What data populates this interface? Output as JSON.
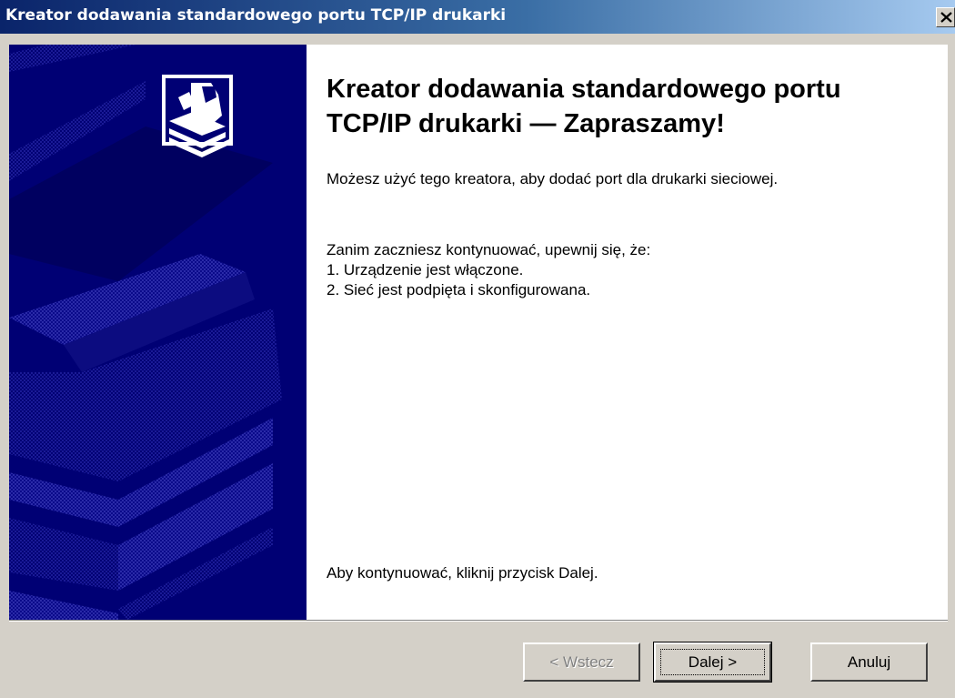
{
  "window": {
    "title": "Kreator dodawania standardowego portu TCP/IP drukarki",
    "close_icon": "close-icon"
  },
  "content": {
    "heading": "Kreator dodawania standardowego portu TCP/IP drukarki — Zapraszamy!",
    "intro": "Możesz użyć tego kreatora, aby dodać port dla drukarki sieciowej.",
    "prereq_header": "Zanim zaczniesz kontynuować, upewnij się, że:",
    "prereq_items": [
      "1.  Urządzenie jest włączone.",
      "2.  Sieć jest podpięta i skonfigurowana."
    ],
    "bottom_hint": "Aby kontynuować, kliknij przycisk Dalej."
  },
  "buttons": {
    "back_label": "< Wstecz",
    "next_label": "Dalej >",
    "cancel_label": "Anuluj"
  },
  "side_panel": {
    "icon": "printer-icon",
    "background_color": "#000074"
  }
}
